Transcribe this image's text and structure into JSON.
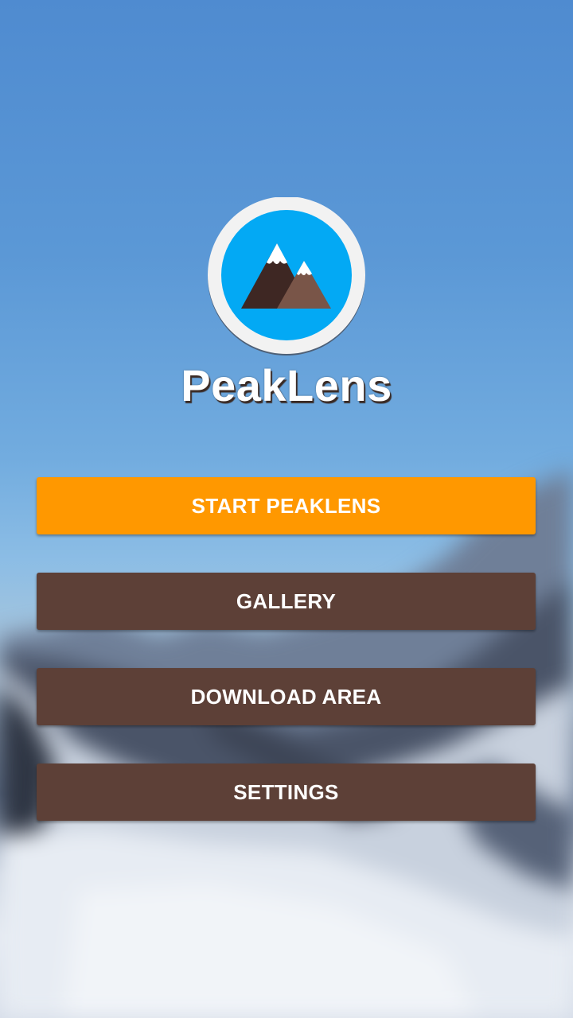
{
  "app": {
    "title": "PeakLens",
    "logo_icon": "mountain-logo-icon"
  },
  "colors": {
    "primary": "#ff9800",
    "secondary": "#5d4037",
    "logo_circle": "#03a9f4",
    "logo_ring": "#f2f2f2"
  },
  "menu": {
    "start_label": "START PEAKLENS",
    "gallery_label": "GALLERY",
    "download_label": "DOWNLOAD AREA",
    "settings_label": "SETTINGS"
  }
}
